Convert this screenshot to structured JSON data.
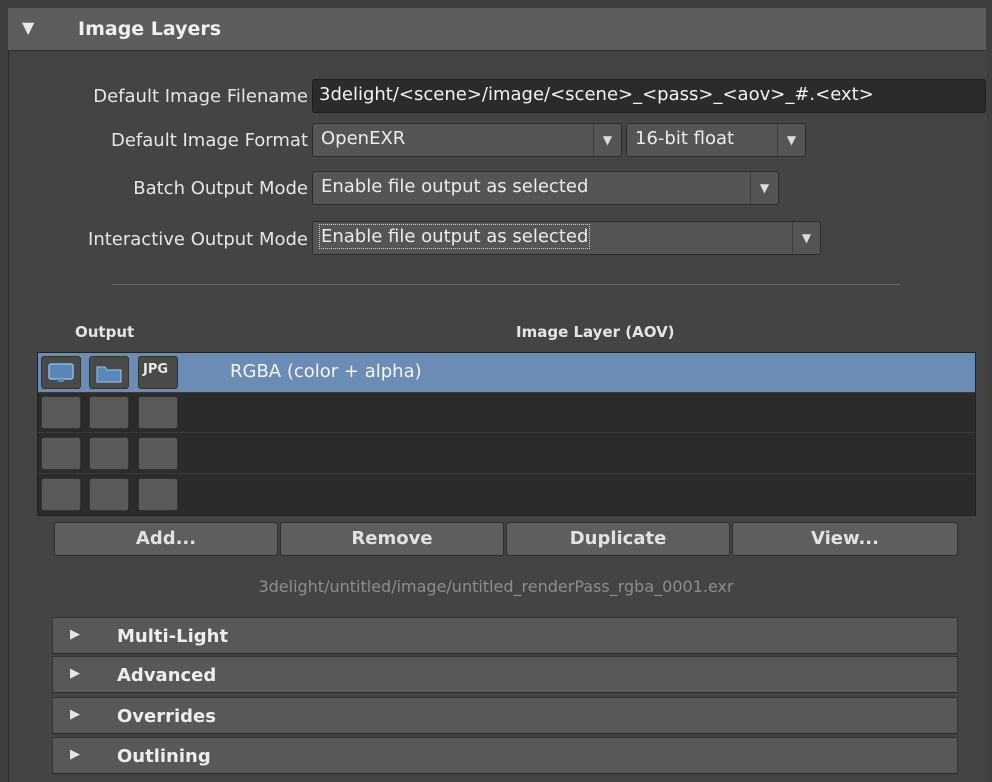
{
  "section": {
    "title": "Image Layers"
  },
  "settings": {
    "filename_label": "Default Image Filename",
    "filename_value": "3delight/<scene>/image/<scene>_<pass>_<aov>_#.<ext>",
    "format_label": "Default Image Format",
    "format_value": "OpenEXR",
    "depth_value": "16-bit float",
    "batch_label": "Batch Output Mode",
    "batch_value": "Enable file output as selected",
    "interactive_label": "Interactive Output Mode",
    "interactive_value": "Enable file output as selected"
  },
  "table": {
    "col_output": "Output",
    "col_aov": "Image Layer (AOV)",
    "rows": [
      {
        "aov": "RGBA (color + alpha)",
        "format_badge": "JPG",
        "selected": true
      },
      {
        "aov": "",
        "selected": false
      },
      {
        "aov": "",
        "selected": false
      },
      {
        "aov": "",
        "selected": false
      }
    ]
  },
  "buttons": {
    "add": "Add...",
    "remove": "Remove",
    "duplicate": "Duplicate",
    "view": "View..."
  },
  "output_path": "3delight/untitled/image/untitled_renderPass_rgba_0001.exr",
  "subsections": [
    {
      "title": "Multi-Light"
    },
    {
      "title": "Advanced"
    },
    {
      "title": "Overrides"
    },
    {
      "title": "Outlining"
    }
  ],
  "colors": {
    "selection": "#6b8db5",
    "panel": "#444444",
    "field": "#2b2b2b"
  },
  "icons": [
    "collapse-triangle-icon",
    "monitor-icon",
    "folder-icon",
    "jpg-format-icon",
    "dropdown-arrow-icon",
    "expand-triangle-icon"
  ]
}
